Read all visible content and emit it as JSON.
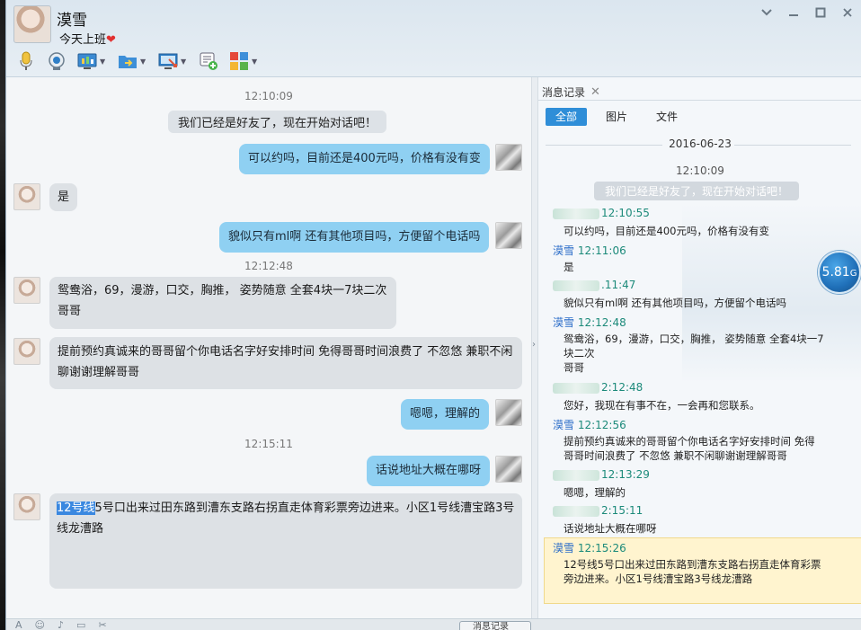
{
  "contact": {
    "name": "漠雪",
    "status": "今天上班",
    "status_emoji": "❤"
  },
  "window_controls": [
    "chevron-down-icon",
    "minimize-icon",
    "maximize-icon",
    "close-icon"
  ],
  "toolbar": [
    "microphone-icon",
    "camera-icon",
    "screen-share-icon",
    "file-transfer-icon",
    "remote-desktop-icon",
    "message-add-icon",
    "apps-icon"
  ],
  "chat": {
    "messages": [
      {
        "kind": "time",
        "text": "12:10:09"
      },
      {
        "kind": "system",
        "text": "我们已经是好友了，现在开始对话吧！"
      },
      {
        "kind": "out",
        "text": "可以约吗，目前还是400元吗，价格有没有变"
      },
      {
        "kind": "in",
        "text": "是"
      },
      {
        "kind": "out",
        "text": "貌似只有ml啊 还有其他项目吗，方便留个电话吗"
      },
      {
        "kind": "time",
        "text": "12:12:48"
      },
      {
        "kind": "in",
        "lines": [
          "鸳鸯浴，69，漫游，口交，胸推， 姿势随意 全套4块一7块二次",
          "哥哥"
        ]
      },
      {
        "kind": "in",
        "lines": [
          "提前预约真诚来的哥哥留个你电话名字好安排时间 免得哥哥时间浪费了 不忽悠 兼职不闲",
          "聊谢谢理解哥哥"
        ]
      },
      {
        "kind": "out",
        "text": "嗯嗯，理解的"
      },
      {
        "kind": "time",
        "text": "12:15:11"
      },
      {
        "kind": "out",
        "text": "话说地址大概在哪呀"
      },
      {
        "kind": "in",
        "highlight": "12号线",
        "rest": "5号口出来过田东路到漕东支路右拐直走体育彩票旁边进来。小区1号线漕宝路3号",
        "line2": "线龙漕路"
      }
    ]
  },
  "bottom": {
    "history_button": "消息记录"
  },
  "history": {
    "tab": "消息记录",
    "filters": [
      "全部",
      "图片",
      "文件"
    ],
    "date": "2016-06-23",
    "first_time": "12:10:09",
    "system": "我们已经是好友了，现在开始对话吧！",
    "entries": [
      {
        "name": "",
        "time": "12:10:55",
        "lines": [
          "可以约吗，目前还是400元吗，价格有没有变"
        ]
      },
      {
        "name": "漠雪",
        "time": "12:11:06",
        "lines": [
          "是"
        ]
      },
      {
        "name": "",
        "time": ".11:47",
        "lines": [
          "貌似只有ml啊 还有其他项目吗，方便留个电话吗"
        ]
      },
      {
        "name": "漠雪",
        "time": "12:12:48",
        "lines": [
          "鸳鸯浴，69，漫游，口交，胸推， 姿势随意 全套4块一7",
          "块二次",
          "哥哥"
        ]
      },
      {
        "name": "",
        "time": "2:12:48",
        "lines": [
          "您好，我现在有事不在，一会再和您联系。"
        ]
      },
      {
        "name": "漠雪",
        "time": "12:12:56",
        "lines": [
          "提前预约真诚来的哥哥留个你电话名字好安排时间 免得",
          "哥哥时间浪费了 不忽悠 兼职不闲聊谢谢理解哥哥"
        ]
      },
      {
        "name": "",
        "time": "12:13:29",
        "lines": [
          "嗯嗯，理解的"
        ]
      },
      {
        "name": "",
        "time": "2:15:11",
        "lines": [
          "话说地址大概在哪呀"
        ]
      },
      {
        "name": "漠雪",
        "time": "12:15:26",
        "lines": [
          "12号线5号口出来过田东路到漕东支路右拐直走体育彩票",
          "旁边进来。小区1号线漕宝路3号线龙漕路"
        ]
      }
    ]
  },
  "speed_badge": {
    "value": "5.81",
    "unit": "G"
  },
  "colors": {
    "bubble_out": "#8fd0f2",
    "bubble_in": "#dde1e5",
    "accent": "#2f8ed8",
    "selected": "#fff4cf"
  }
}
